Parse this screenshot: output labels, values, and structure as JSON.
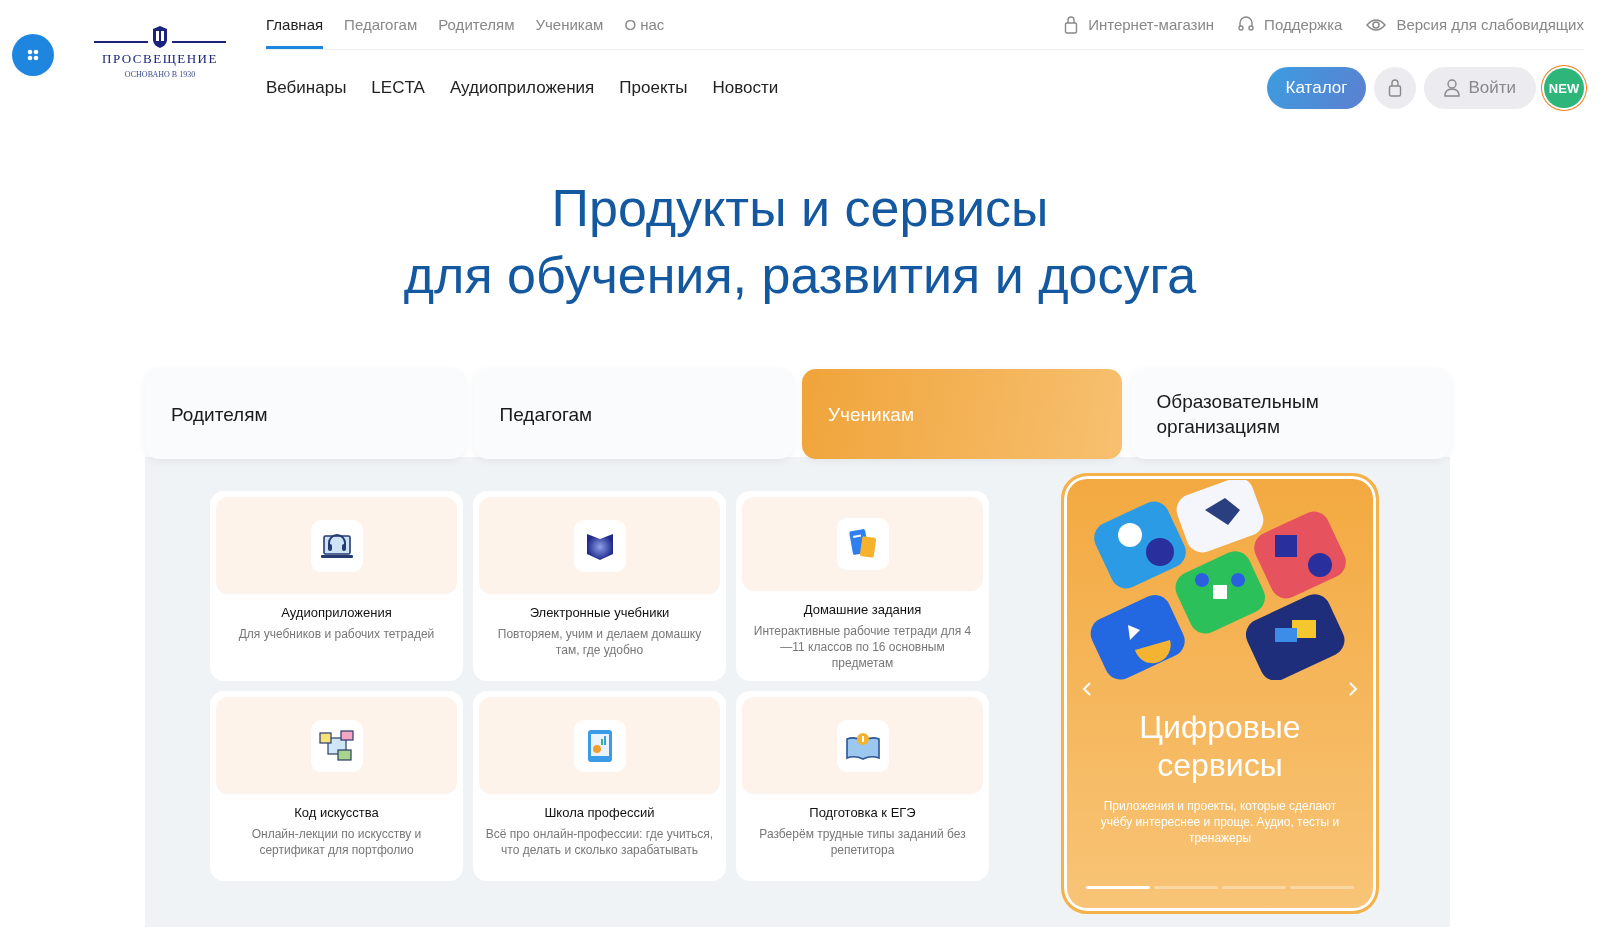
{
  "logo": {
    "name": "ПРОСВЕЩЕНИЕ",
    "tagline": "ОСНОВАНО В 1930"
  },
  "top_nav": [
    {
      "label": "Главная",
      "selected": true
    },
    {
      "label": "Педагогам",
      "selected": false
    },
    {
      "label": "Родителям",
      "selected": false
    },
    {
      "label": "Ученикам",
      "selected": false
    },
    {
      "label": "О нас",
      "selected": false
    }
  ],
  "utility_links": [
    {
      "kind": "shop",
      "label": "Интернет-магазин"
    },
    {
      "kind": "support",
      "label": "Поддержка"
    },
    {
      "kind": "vision",
      "label": "Версия для слабовидящих"
    }
  ],
  "secondary_nav": [
    "Вебинары",
    "LECTA",
    "Аудиоприложения",
    "Проекты",
    "Новости"
  ],
  "actions": {
    "catalog": "Каталог",
    "login": "Войти",
    "badge": "NEW"
  },
  "hero": {
    "line_1": "Продукты и сервисы",
    "line_2": "для обучения, развития и досуга"
  },
  "audience_tabs": [
    {
      "label": "Родителям",
      "selected": false
    },
    {
      "label": "Педагогам",
      "selected": false
    },
    {
      "label": "Ученикам",
      "selected": true
    },
    {
      "label": "Образовательным организациям",
      "selected": false
    }
  ],
  "services": [
    {
      "kind": "audio",
      "title": "Аудиоприложения",
      "description": "Для учебников и рабочих тетрадей"
    },
    {
      "kind": "ebook",
      "title": "Электронные учебники",
      "description": "Повторяем, учим и делаем домашку там, где удобно"
    },
    {
      "kind": "homework",
      "title": "Домашние задания",
      "description": "Интерактивные рабочие тетради для 4—11 классов по 16 основным предметам"
    },
    {
      "kind": "art",
      "title": "Код искусства",
      "description": "Онлайн-лекции по искусству и сертификат для портфолио"
    },
    {
      "kind": "professions",
      "title": "Школа профессий",
      "description": "Всё про онлайн-профессии: где учиться, что делать и сколько зарабатывать"
    },
    {
      "kind": "exam",
      "title": "Подготовка к ЕГЭ",
      "description": "Разберём трудные типы заданий без репетитора"
    }
  ],
  "promo": {
    "title_line_1": "Цифровые",
    "title_line_2": "сервисы",
    "text": "Приложения и проекты, которые сделают учёбу интереснее и проще. Аудио, тесты и тренажеры",
    "slides": [
      {
        "selected": true
      },
      {
        "selected": false
      },
      {
        "selected": false
      },
      {
        "selected": false
      }
    ]
  }
}
